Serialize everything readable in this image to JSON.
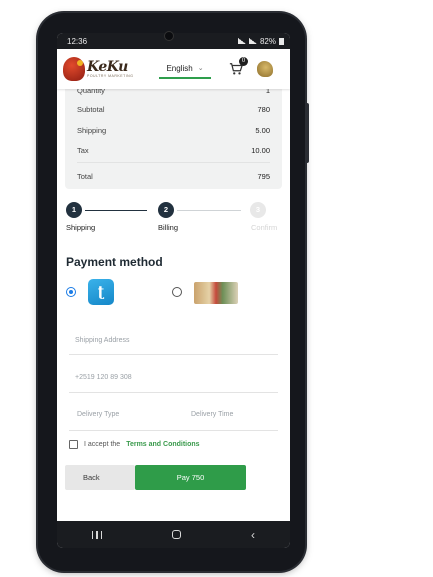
{
  "status_bar": {
    "time": "12:36",
    "battery": "82%"
  },
  "header": {
    "logo_text": "KeKu",
    "logo_tagline": "POULTRY MARKETING",
    "language": "English",
    "cart_count": "0"
  },
  "order_summary": {
    "cutoff_label": "Quantity",
    "cutoff_value": "1",
    "rows": [
      {
        "label": "Subtotal",
        "value": "780"
      },
      {
        "label": "Shipping",
        "value": "5.00"
      },
      {
        "label": "Tax",
        "value": "10.00"
      }
    ],
    "total": {
      "label": "Total",
      "value": "795"
    }
  },
  "stepper": {
    "steps": [
      {
        "number": "1",
        "label": "Shipping",
        "state": "done"
      },
      {
        "number": "2",
        "label": "Billing",
        "state": "active"
      },
      {
        "number": "3",
        "label": "Confirm",
        "state": "inactive"
      }
    ]
  },
  "payment": {
    "title": "Payment method",
    "options": [
      {
        "name": "telebirr",
        "selected": true
      },
      {
        "name": "bank",
        "selected": false
      }
    ]
  },
  "form": {
    "shipping_address_placeholder": "Shipping Address",
    "phone_value": "+2519 120 89 308",
    "delivery_type_placeholder": "Delivery Type",
    "delivery_time_placeholder": "Delivery Time"
  },
  "terms": {
    "prefix": "I accept the",
    "link": "Terms and Conditions"
  },
  "actions": {
    "back_label": "Back",
    "pay_label": "Pay 750"
  },
  "colors": {
    "accent_green": "#2f9c49",
    "step_dark": "#22313f",
    "radio_blue": "#1b7ce6"
  }
}
